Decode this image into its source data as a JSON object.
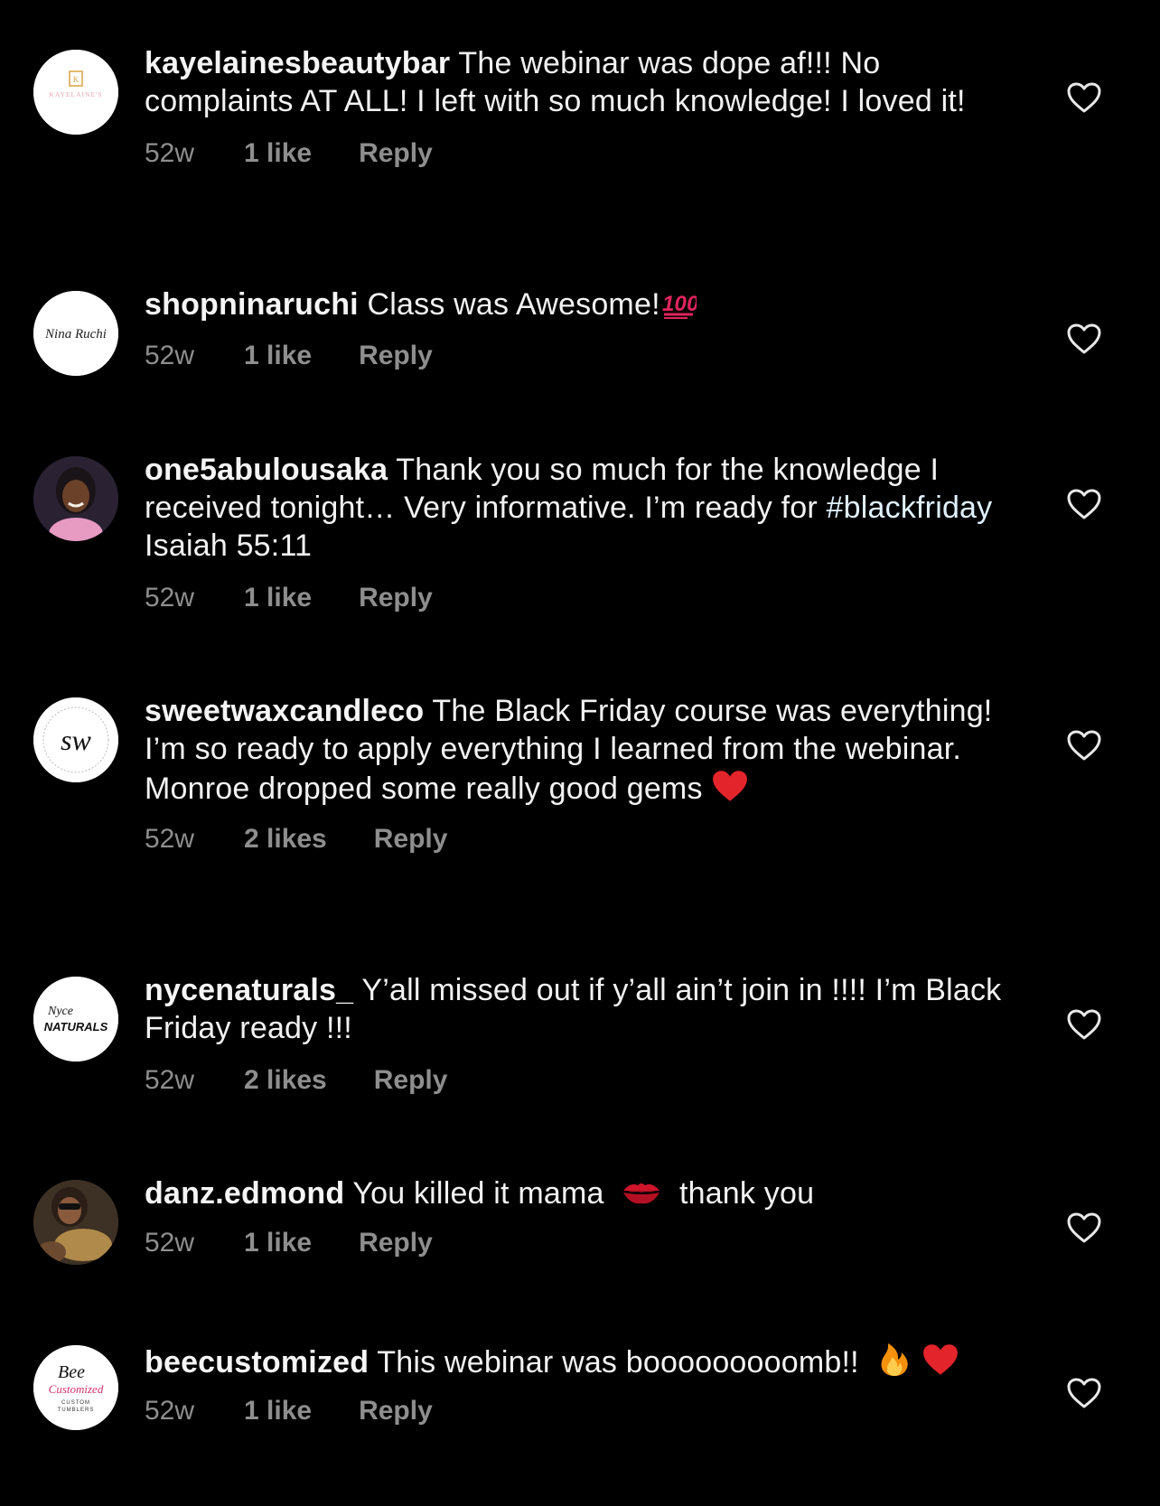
{
  "comments": [
    {
      "username": "kayelainesbeautybar",
      "text": "The webinar was dope af!!! No complaints AT ALL! I left with so much knowledge! I loved it!",
      "time": "52w",
      "likes": "1 like",
      "reply": "Reply",
      "avatar_text": "KAYELAINE'S"
    },
    {
      "username": "shopninaruchi",
      "text": "Class was Awesome!",
      "emoji_after": "hundred-points-icon",
      "time": "52w",
      "likes": "1 like",
      "reply": "Reply",
      "avatar_text": "Nina Ruchi"
    },
    {
      "username": "one5abulousaka",
      "text_before": "Thank you so much for the knowledge I received tonight… Very informative. I’m ready for",
      "hashtag": "#blackfriday",
      "text_after": "Isaiah 55:11",
      "time": "52w",
      "likes": "1 like",
      "reply": "Reply"
    },
    {
      "username": "sweetwaxcandleco",
      "text": "The Black Friday course was everything! I’m so ready to apply everything I learned from the webinar. Monroe dropped some really good gems",
      "emoji_after": "red-heart-icon",
      "time": "52w",
      "likes": "2 likes",
      "reply": "Reply",
      "avatar_text": "sw"
    },
    {
      "username": "nycenaturals_",
      "text": "Y’all missed out if y’all ain’t join in !!!! I’m Black Friday ready !!!",
      "time": "52w",
      "likes": "2 likes",
      "reply": "Reply",
      "avatar_text_1": "Nyce",
      "avatar_text_2": "NATURALS"
    },
    {
      "username": "danz.edmond",
      "text_before": "You killed it mama",
      "emoji_middle": "kiss-mark-icon",
      "text_after": "thank you",
      "time": "52w",
      "likes": "1 like",
      "reply": "Reply"
    },
    {
      "username": "beecustomized",
      "text": "This webinar was booooooooomb!!",
      "emoji_after": "fire-icon",
      "emoji_after_2": "red-heart-icon",
      "time": "52w",
      "likes": "1 like",
      "reply": "Reply",
      "avatar_text_1": "Bee",
      "avatar_text_2": "Customized",
      "avatar_text_3": "CUSTOM",
      "avatar_text_4": "TUMBLERS"
    }
  ],
  "colors": {
    "background": "#000000",
    "text": "#f2f2f2",
    "meta": "#8e8e8e",
    "hashtag": "#e0f1ff",
    "heart_outline": "#e8e8e8"
  }
}
